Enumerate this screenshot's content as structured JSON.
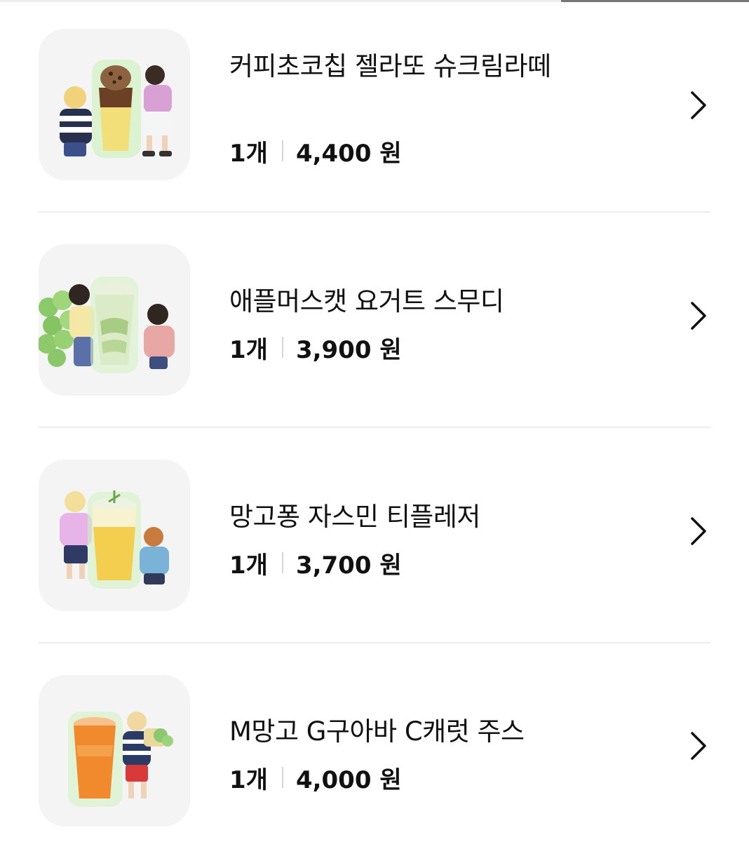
{
  "colors": {
    "background": "#ffffff",
    "thumbnail_bg": "#f4f4f5",
    "divider": "#ececec",
    "text": "#111111",
    "separator": "#d6d6d6"
  },
  "items": [
    {
      "name": "커피초코칩 젤라또 슈크림라떼",
      "quantity": "1개",
      "price": "4,400 원",
      "thumbnail_icon": "coffee-gelato-drink-image",
      "action_icon": "chevron-right-icon"
    },
    {
      "name": "애플머스캣 요거트 스무디",
      "quantity": "1개",
      "price": "3,900 원",
      "thumbnail_icon": "muscat-smoothie-drink-image",
      "action_icon": "chevron-right-icon"
    },
    {
      "name": "망고퐁 자스민 티플레저",
      "quantity": "1개",
      "price": "3,700 원",
      "thumbnail_icon": "mango-jasmine-tea-image",
      "action_icon": "chevron-right-icon"
    },
    {
      "name": "M망고 G구아바 C캐럿 주스",
      "quantity": "1개",
      "price": "4,000 원",
      "thumbnail_icon": "mango-guava-carrot-juice-image",
      "action_icon": "chevron-right-icon"
    }
  ]
}
